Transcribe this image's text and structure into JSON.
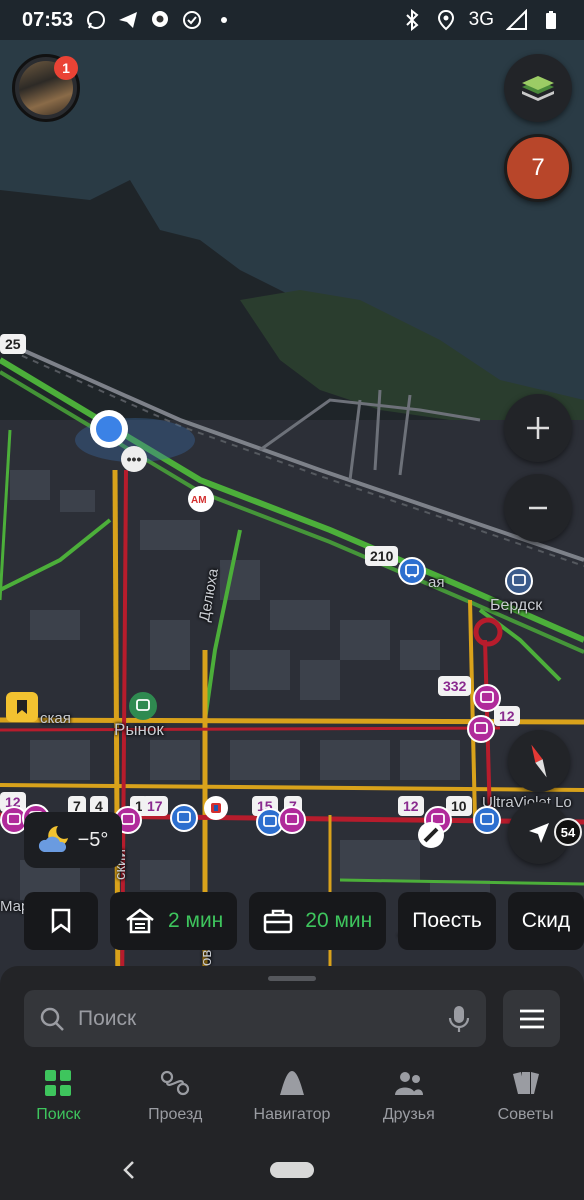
{
  "status": {
    "time": "07:53",
    "network": "3G"
  },
  "avatar": {
    "badge": "1"
  },
  "traffic": {
    "level": "7"
  },
  "weather": {
    "temp": "−5°"
  },
  "map": {
    "labels": {
      "delyuha": "Делюха",
      "berdsk": "Бердск",
      "rynok": "Рынок",
      "skaya": "ская",
      "aya": "ая",
      "ultraviolet": "UltraViolet Lo",
      "mar": "Мар",
      "skiy": "ский",
      "tv": "Т",
      "ov": "ов"
    },
    "routes": {
      "r25": "25",
      "r210": "210",
      "r332": "332",
      "r12a": "12",
      "r12b": "12",
      "r12c": "12",
      "r7a": "7",
      "r4": "4",
      "r1": "1",
      "r17": "17",
      "r15": "15",
      "r7b": "7",
      "r10": "10"
    },
    "speed": "54"
  },
  "chips": {
    "home_time": "2 мин",
    "work_time": "20 мин",
    "eat": "Поесть",
    "discounts": "Скид"
  },
  "search": {
    "placeholder": "Поиск"
  },
  "tabs": [
    {
      "label": "Поиск"
    },
    {
      "label": "Проезд"
    },
    {
      "label": "Навигатор"
    },
    {
      "label": "Друзья"
    },
    {
      "label": "Советы"
    }
  ],
  "colors": {
    "accent": "#3ec55d",
    "traffic_badge": "#b8462a",
    "route_green": "#4caf3a",
    "route_yellow": "#d9a21b",
    "route_red": "#b71c2c"
  }
}
